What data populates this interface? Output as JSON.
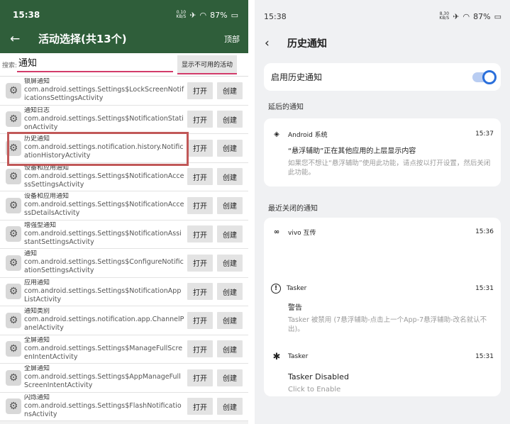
{
  "left": {
    "status": {
      "time": "15:38",
      "net_speed": "0.10",
      "net_unit": "KB/S",
      "battery": "87%"
    },
    "appbar": {
      "title": "活动选择(共13个)",
      "top_label": "顶部"
    },
    "search": {
      "label": "搜索:",
      "value": "通知",
      "toggle_button": "显示不可用的活动"
    },
    "open_label": "打开",
    "create_label": "创建",
    "items": [
      {
        "name": "锁屏通知",
        "class": "com.android.settings.Settings$LockScreenNotificationsSettingsActivity"
      },
      {
        "name": "通知日志",
        "class": "com.android.settings.Settings$NotificationStationActivity"
      },
      {
        "name": "历史通知",
        "class": "com.android.settings.notification.history.NotificationHistoryActivity"
      },
      {
        "name": "设备和应用通知",
        "class": "com.android.settings.Settings$NotificationAccessSettingsActivity"
      },
      {
        "name": "设备和应用通知",
        "class": "com.android.settings.Settings$NotificationAccessDetailsActivity"
      },
      {
        "name": "增强型通知",
        "class": "com.android.settings.Settings$NotificationAssistantSettingsActivity"
      },
      {
        "name": "通知",
        "class": "com.android.settings.Settings$ConfigureNotificationSettingsActivity"
      },
      {
        "name": "应用通知",
        "class": "com.android.settings.Settings$NotificationAppListActivity"
      },
      {
        "name": "通知类别",
        "class": "com.android.settings.notification.app.ChannelPanelActivity"
      },
      {
        "name": "全屏通知",
        "class": "com.android.settings.Settings$ManageFullScreenIntentActivity"
      },
      {
        "name": "全屏通知",
        "class": "com.android.settings.Settings$AppManageFullScreenIntentActivity"
      },
      {
        "name": "闪烁通知",
        "class": "com.android.settings.Settings$FlashNotificationsActivity"
      }
    ]
  },
  "right": {
    "status": {
      "time": "15:38",
      "net_speed": "8.30",
      "net_unit": "KB/S",
      "battery": "87%"
    },
    "appbar": {
      "title": "历史通知"
    },
    "toggle": {
      "label": "启用历史通知",
      "enabled": true
    },
    "snoozed_header": "延后的通知",
    "snoozed": {
      "app": "Android 系统",
      "time": "15:37",
      "title": "“悬浮辅助”正在其他应用的上层显示内容",
      "body": "如果您不想让“悬浮辅助”使用此功能，请点按以打开设置，然后关闭此功能。"
    },
    "dismissed_header": "最近关闭的通知",
    "dismissed": [
      {
        "app": "vivo 互传",
        "time": "15:36",
        "title": "",
        "body": "",
        "icon": "vivo-share-icon"
      },
      {
        "app": "Tasker",
        "time": "15:31",
        "title": "警告",
        "body": "Tasker 被禁用 (7悬浮辅助-点击上一个App-7悬浮辅助-改名就认不出)。",
        "icon": "warning-icon"
      },
      {
        "app": "Tasker",
        "time": "15:31",
        "title": "Tasker Disabled",
        "body": "Click to Enable",
        "icon": "tasker-gear-icon"
      }
    ]
  }
}
